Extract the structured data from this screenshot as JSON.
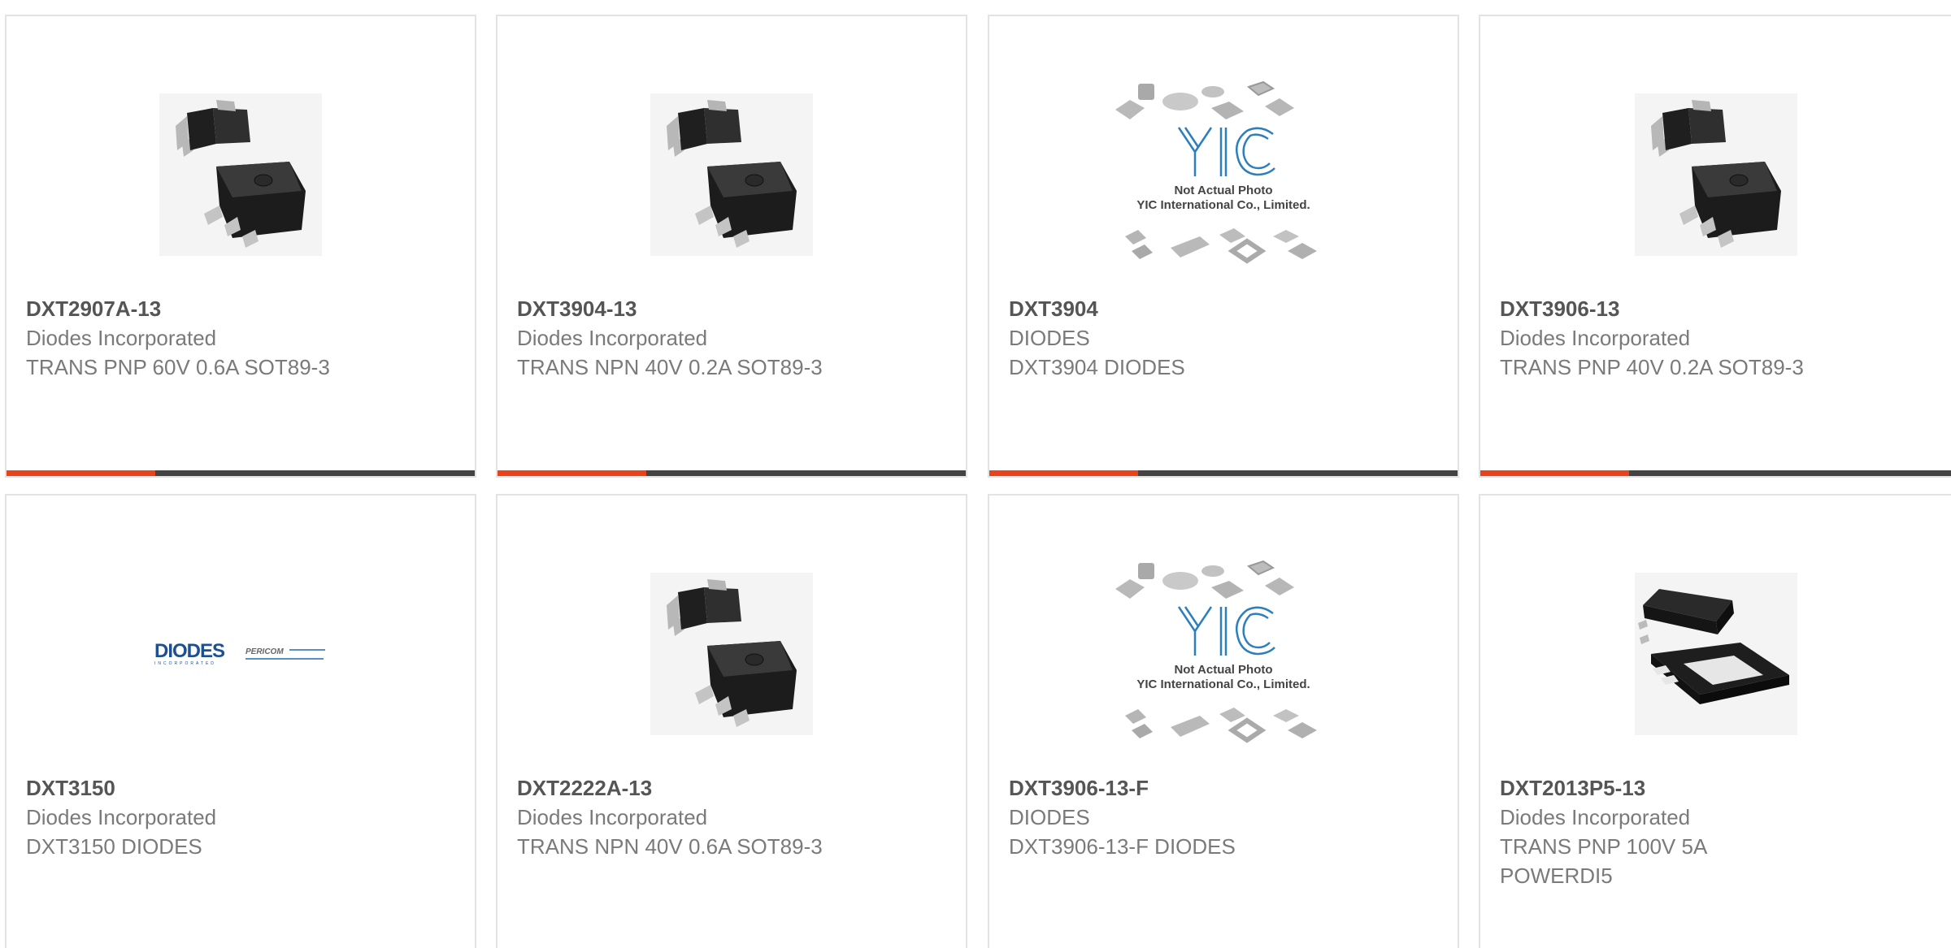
{
  "cards": [
    {
      "part": "DXT2907A-13",
      "manufacturer": "Diodes Incorporated",
      "description": "TRANS PNP 60V 0.6A SOT89-3",
      "image": "sot89-photo"
    },
    {
      "part": "DXT3904-13",
      "manufacturer": "Diodes Incorporated",
      "description": "TRANS NPN 40V 0.2A SOT89-3",
      "image": "sot89-photo"
    },
    {
      "part": "DXT3904",
      "manufacturer": "DIODES",
      "description": "DXT3904 DIODES",
      "image": "yic-placeholder"
    },
    {
      "part": "DXT3906-13",
      "manufacturer": "Diodes Incorporated",
      "description": "TRANS PNP 40V 0.2A SOT89-3",
      "image": "sot89-photo"
    },
    {
      "part": "DXT3150",
      "manufacturer": "Diodes Incorporated",
      "description": "DXT3150 DIODES",
      "image": "diodes-pericom-logo"
    },
    {
      "part": "DXT2222A-13",
      "manufacturer": "Diodes Incorporated",
      "description": "TRANS NPN 40V 0.6A SOT89-3",
      "image": "sot89-photo"
    },
    {
      "part": "DXT3906-13-F",
      "manufacturer": "DIODES",
      "description": "DXT3906-13-F DIODES",
      "image": "yic-placeholder"
    },
    {
      "part": "DXT2013P5-13",
      "manufacturer": "Diodes Incorporated",
      "description": "TRANS PNP 100V 5A POWERDI5",
      "image": "powerdi5-photo"
    }
  ],
  "placeholder": {
    "brand": "YIC",
    "line1": "Not Actual Photo",
    "line2": "YIC International Co., Limited."
  },
  "logos": {
    "diodes": "DIODES",
    "diodes_sub": "INCORPORATED",
    "pericom": "PERICOM"
  },
  "colors": {
    "accent": "#e8431b",
    "bar": "#434343",
    "border": "#e3e3e3"
  }
}
